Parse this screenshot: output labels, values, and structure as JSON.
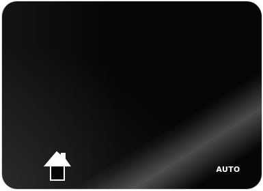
{
  "controls": {
    "home_icon": "home-icon",
    "mode_label": "AUTO"
  },
  "colors": {
    "screen_background": "#050505",
    "foreground": "#ffffff",
    "frame_outline": "#d8d8d8"
  }
}
